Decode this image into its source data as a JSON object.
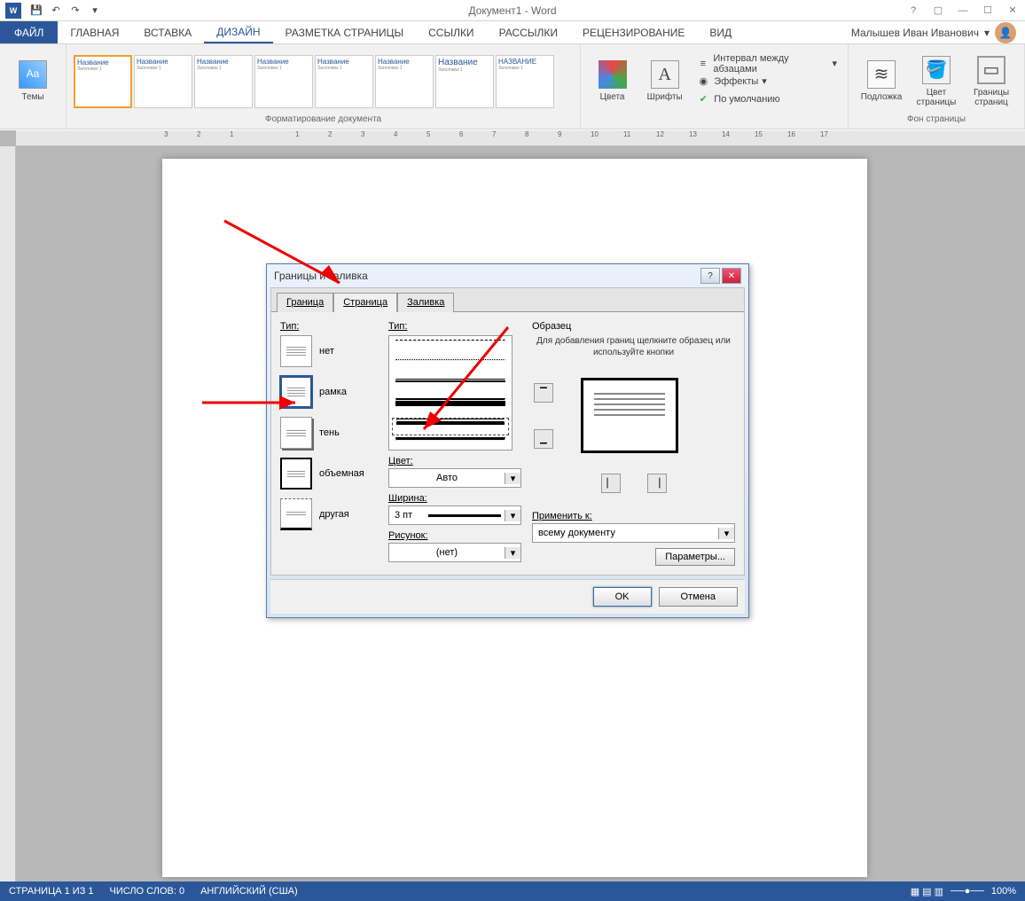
{
  "title": "Документ1 - Word",
  "user": "Малышев Иван Иванович",
  "tabs": {
    "file": "ФАЙЛ",
    "items": [
      "ГЛАВНАЯ",
      "ВСТАВКА",
      "ДИЗАЙН",
      "РАЗМЕТКА СТРАНИЦЫ",
      "ССЫЛКИ",
      "РАССЫЛКИ",
      "РЕЦЕНЗИРОВАНИЕ",
      "ВИД"
    ],
    "active": 2
  },
  "ribbon": {
    "themes": "Темы",
    "format_label": "Форматирование документа",
    "colors": "Цвета",
    "fonts": "Шрифты",
    "spacing": "Интервал между абзацами",
    "effects": "Эффекты",
    "default": "По умолчанию",
    "watermark": "Подложка",
    "page_color": "Цвет страницы",
    "page_borders": "Границы страниц",
    "page_bg_label": "Фон страницы",
    "theme_samples": [
      "Название",
      "Название",
      "Название",
      "Название",
      "Название",
      "Название",
      "Название",
      "НАЗВАНИЕ"
    ],
    "heading_sample": "Заголовок 1"
  },
  "dialog": {
    "title": "Границы и заливка",
    "tabs": [
      "Граница",
      "Страница",
      "Заливка"
    ],
    "active_tab": 1,
    "type_label": "Тип:",
    "type_options": [
      "нет",
      "рамка",
      "тень",
      "объемная",
      "другая"
    ],
    "type_selected": 1,
    "style_label": "Тип:",
    "color_label": "Цвет:",
    "color_value": "Авто",
    "width_label": "Ширина:",
    "width_value": "3 пт",
    "art_label": "Рисунок:",
    "art_value": "(нет)",
    "preview_label": "Образец",
    "preview_hint": "Для добавления границ щелкните образец или используйте кнопки",
    "apply_label": "Применить к:",
    "apply_value": "всему документу",
    "params": "Параметры...",
    "ok": "OK",
    "cancel": "Отмена"
  },
  "status": {
    "page": "СТРАНИЦА 1 ИЗ 1",
    "words": "ЧИСЛО СЛОВ: 0",
    "lang": "АНГЛИЙСКИЙ (США)",
    "zoom": "100%"
  },
  "ruler_nums": [
    "3",
    "2",
    "1",
    "",
    "1",
    "2",
    "3",
    "4",
    "5",
    "6",
    "7",
    "8",
    "9",
    "10",
    "11",
    "12",
    "13",
    "14",
    "15",
    "16",
    "17"
  ]
}
